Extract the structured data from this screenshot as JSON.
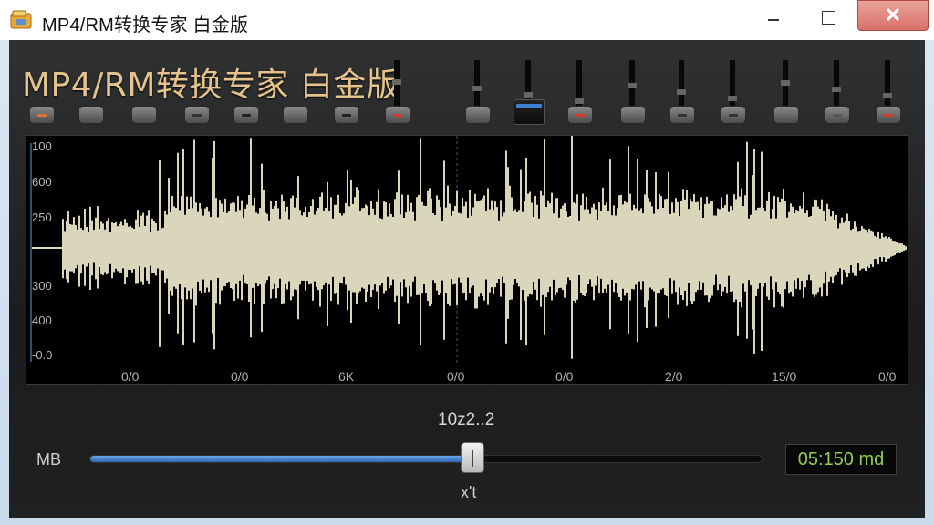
{
  "window": {
    "title": "MP4/RM转换专家 白金版",
    "close_symbol": "✕"
  },
  "brand": "MP4/RM转换专家 白金版",
  "toolbar": {
    "buttons": [
      {
        "name": "tool-button-1",
        "icon": "orange-dot-icon"
      },
      {
        "name": "tool-button-2",
        "icon": "blank-icon"
      },
      {
        "name": "tool-button-3",
        "icon": "blank-icon"
      },
      {
        "name": "tool-button-4",
        "icon": "plus-icon"
      },
      {
        "name": "tool-button-5",
        "icon": "split-icon"
      },
      {
        "name": "tool-button-6",
        "icon": "blank-icon"
      },
      {
        "name": "tool-button-7",
        "icon": "pause-icon"
      },
      {
        "name": "tool-button-8",
        "icon": "red-mark-icon"
      },
      {
        "name": "tool-button-9",
        "icon": "blank-icon"
      },
      {
        "name": "tool-button-10",
        "icon": "blue-bar-icon",
        "selected": true
      },
      {
        "name": "tool-button-11",
        "icon": "red-line-icon"
      },
      {
        "name": "tool-button-12",
        "icon": "blank-icon"
      },
      {
        "name": "tool-button-13",
        "icon": "play-icon"
      },
      {
        "name": "tool-button-14",
        "icon": "lines-icon"
      },
      {
        "name": "tool-button-15",
        "icon": "blank-icon"
      },
      {
        "name": "tool-button-16",
        "icon": "dash-icon"
      },
      {
        "name": "tool-button-17",
        "icon": "red-slash-icon"
      }
    ]
  },
  "waveform": {
    "y_labels": [
      "100",
      "600",
      "250",
      "300",
      "400",
      "-0.0"
    ],
    "x_labels": [
      "0/0",
      "0/0",
      "6K",
      "0/0",
      "0/0",
      "2/0",
      "15/0",
      "0/0"
    ],
    "color": "#d9d6bc"
  },
  "position_readout": "10z2..2",
  "mb_label": "MB",
  "slider": {
    "value_percent": 57
  },
  "thumb_label": "x't",
  "time_display": "05:150 md",
  "colors": {
    "accent": "#4a86d6",
    "brand": "#e4c48c",
    "time": "#8fd14f"
  }
}
